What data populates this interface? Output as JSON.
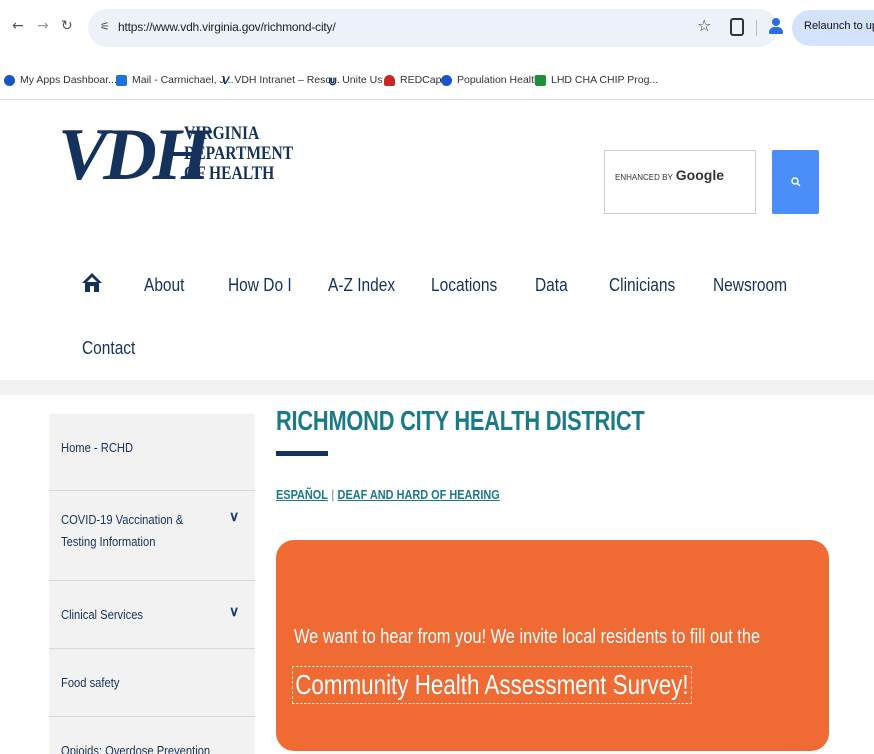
{
  "browser": {
    "url": "https://www.vdh.virginia.gov/richmond-city/",
    "relaunch_label": "Relaunch to update",
    "bookmarks": [
      {
        "label": "My Apps Dashboar...",
        "icon": "circle-icon",
        "color": "#1a55c4"
      },
      {
        "label": "Mail - Carmichael, J...",
        "icon": "outlook-icon",
        "color": "#1e73d6"
      },
      {
        "label": "VDH Intranet – Reso...",
        "icon": "vdh-icon",
        "color": "#14325c"
      },
      {
        "label": "Unite Us",
        "icon": "unite-icon",
        "color": "#14325c"
      },
      {
        "label": "REDCap",
        "icon": "redcap-icon",
        "color": "#c62828"
      },
      {
        "label": "Population Health",
        "icon": "circle-icon",
        "color": "#1a55c4"
      },
      {
        "label": "LHD CHA CHIP Prog...",
        "icon": "sheets-icon",
        "color": "#1f8f3a"
      }
    ]
  },
  "header": {
    "logo_letters": "VDH",
    "logo_line1": "VIRGINIA",
    "logo_line2": "DEPARTMENT",
    "logo_line3": "OF HEALTH",
    "search_enhanced_by": "ENHANCED BY",
    "search_google": "Google"
  },
  "nav": {
    "items": [
      "About",
      "How Do I",
      "A-Z Index",
      "Locations",
      "Data",
      "Clinicians",
      "Newsroom",
      "Contact"
    ]
  },
  "sidebar": {
    "items": [
      {
        "label": "Home - RCHD"
      },
      {
        "label_line1": "COVID-19 Vaccination &",
        "label_line2": "Testing Information"
      },
      {
        "label": "Clinical Services"
      },
      {
        "label": "Food safety"
      },
      {
        "label": "Opioids: Overdose Prevention"
      }
    ]
  },
  "main": {
    "title": "RICHMOND CITY HEALTH DISTRICT",
    "lang_espanol": "ESPAÑOL",
    "lang_separator": "|",
    "lang_deaf": "DEAF AND HARD OF HEARING",
    "banner_text": "We want to hear from you! We invite local residents to fill out the",
    "banner_link": "Community Health Assessment Survey!"
  },
  "colors": {
    "brand_navy": "#14325c",
    "title_teal": "#1b7a8a",
    "banner_orange": "#f06a33",
    "search_blue": "#4c8ef7"
  }
}
